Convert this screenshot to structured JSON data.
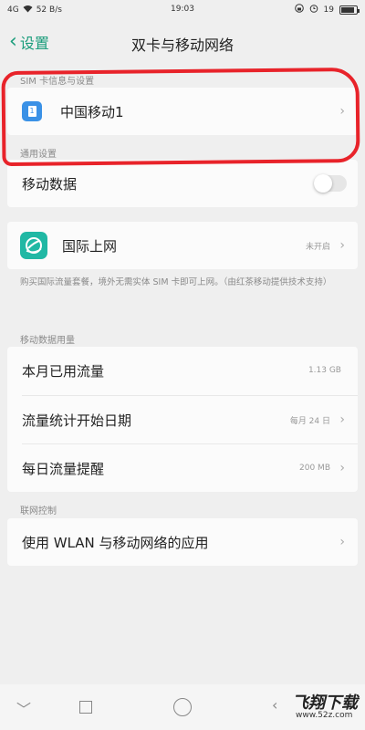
{
  "statusbar": {
    "signal": "4G",
    "speed": "52 B/s",
    "time": "19:03",
    "battery": "19"
  },
  "header": {
    "back_label": "设置",
    "title": "双卡与移动网络"
  },
  "sim_section": {
    "label": "SIM 卡信息与设置",
    "sim_name": "中国移动1"
  },
  "general": {
    "label": "通用设置",
    "mobile_data_label": "移动数据",
    "mobile_data_on": false
  },
  "roaming": {
    "label": "国际上网",
    "value": "未开启",
    "description": "购买国际流量套餐，境外无需实体 SIM 卡即可上网。（由红茶移动提供技术支持）"
  },
  "usage": {
    "label": "移动数据用量",
    "rows": [
      {
        "label": "本月已用流量",
        "value": "1.13 GB"
      },
      {
        "label": "流量统计开始日期",
        "value": "每月 24 日"
      },
      {
        "label": "每日流量提醒",
        "value": "200 MB"
      }
    ]
  },
  "network_control": {
    "label": "联网控制",
    "row_label": "使用 WLAN 与移动网络的应用"
  },
  "watermark": {
    "text": "飞翔下载",
    "url": "www.52z.com"
  }
}
